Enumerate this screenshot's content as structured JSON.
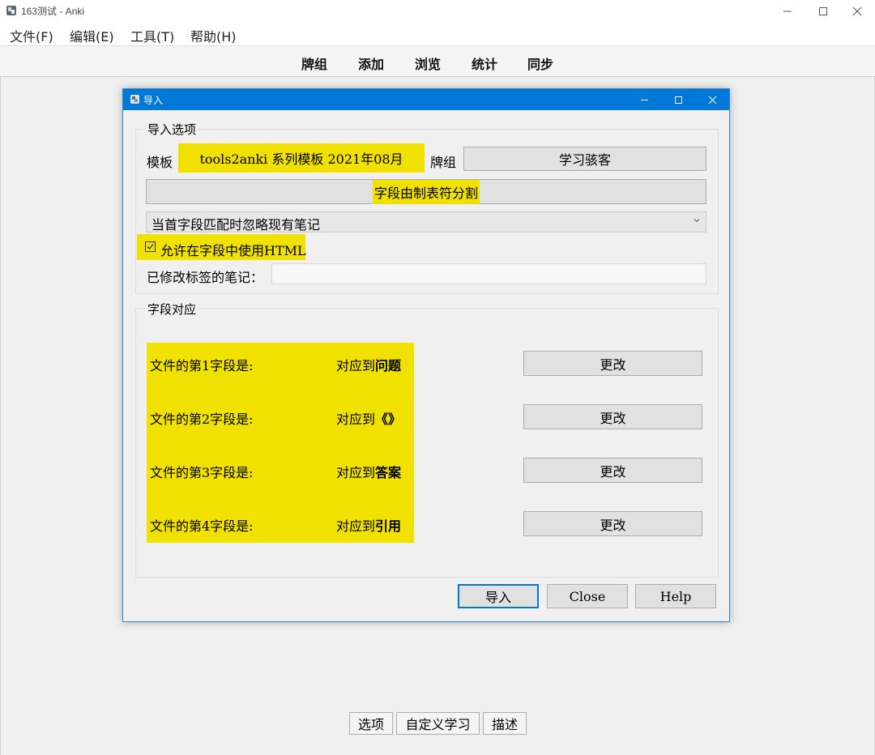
{
  "window": {
    "title": "163测试 - Anki"
  },
  "menu": [
    "文件(F)",
    "编辑(E)",
    "工具(T)",
    "帮助(H)"
  ],
  "toolbar": [
    "牌组",
    "添加",
    "浏览",
    "统计",
    "同步"
  ],
  "bottom_buttons": [
    "选项",
    "自定义学习",
    "描述"
  ],
  "dialog": {
    "title": "导入",
    "options_group": "导入选项",
    "note_type_label": "模板",
    "note_type_value": "tools2anki 系列模板 2021年08月",
    "deck_label": "牌组",
    "deck_value": "学习骇客",
    "separator_button": "字段由制表符分割",
    "duplicate_option": "当首字段匹配时忽略现有笔记",
    "allow_html_checkbox": "允许在字段中使用HTML",
    "allow_html_checked": true,
    "tag_label": "已修改标签的笔记：",
    "tag_value": "",
    "mapping_group": "字段对应",
    "mappings": [
      {
        "source": "文件的第1字段是:",
        "prefix": "对应到",
        "target": "问题",
        "change": "更改"
      },
      {
        "source": "文件的第2字段是:",
        "prefix": "对应到",
        "target": "《》",
        "change": "更改"
      },
      {
        "source": "文件的第3字段是:",
        "prefix": "对应到",
        "target": "答案",
        "change": "更改"
      },
      {
        "source": "文件的第4字段是:",
        "prefix": "对应到",
        "target": "引用",
        "change": "更改"
      }
    ],
    "buttons": {
      "import": "导入",
      "close": "Close",
      "help": "Help"
    }
  },
  "colors": {
    "highlight": "#f0e100",
    "dialog_titlebar": "#0078d7"
  }
}
